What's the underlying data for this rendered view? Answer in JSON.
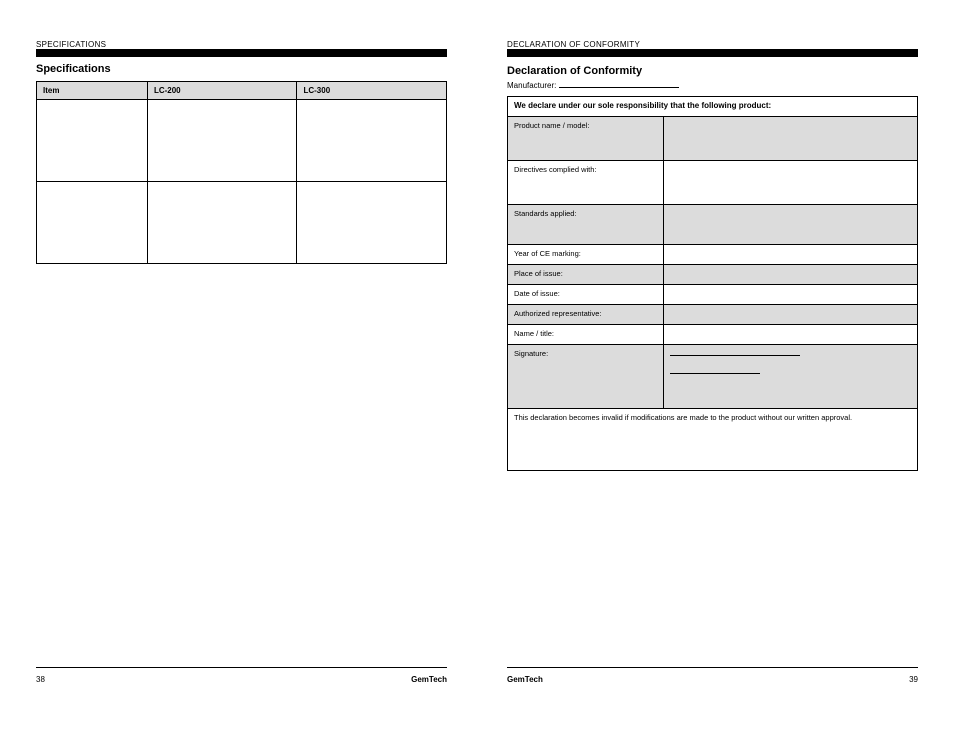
{
  "left": {
    "overline": "SPECIFICATIONS",
    "title": "Specifications",
    "table": {
      "headers": [
        "Item",
        "LC-200",
        "LC-300"
      ],
      "rows": [
        {
          "item": "",
          "a": "",
          "b": ""
        },
        {
          "item": "",
          "a": "",
          "b": ""
        }
      ]
    },
    "page_number": "38",
    "brand": "GemTech"
  },
  "right": {
    "overline": "DECLARATION OF CONFORMITY",
    "title": "Declaration of Conformity",
    "mfr_label": "Manufacturer:",
    "mfr_value": " ",
    "header_text": "We declare under our sole responsibility that the following product:",
    "rows": [
      {
        "label": "Product name / model:",
        "value": "",
        "shade": true,
        "tall": true
      },
      {
        "label": "Directives complied with:",
        "value": "",
        "shade": false,
        "tall": true
      },
      {
        "label": "Standards applied:",
        "value": "",
        "shade": true,
        "tall": true
      },
      {
        "label": "Year of CE marking:",
        "value": "",
        "shade": false,
        "tall": false
      },
      {
        "label": "Place of issue:",
        "value": "",
        "shade": true,
        "tall": false
      },
      {
        "label": "Date of issue:",
        "value": "",
        "shade": false,
        "tall": false
      },
      {
        "label": "Authorized representative:",
        "value": "",
        "shade": true,
        "tall": false
      },
      {
        "label": "Name / title:",
        "value": "",
        "shade": false,
        "tall": false
      }
    ],
    "sig_label": "Signature:",
    "link1": " ",
    "link2": " ",
    "note": "This declaration becomes invalid if modifications are made to the product without our written approval.",
    "page_number": "39",
    "brand": "GemTech"
  }
}
